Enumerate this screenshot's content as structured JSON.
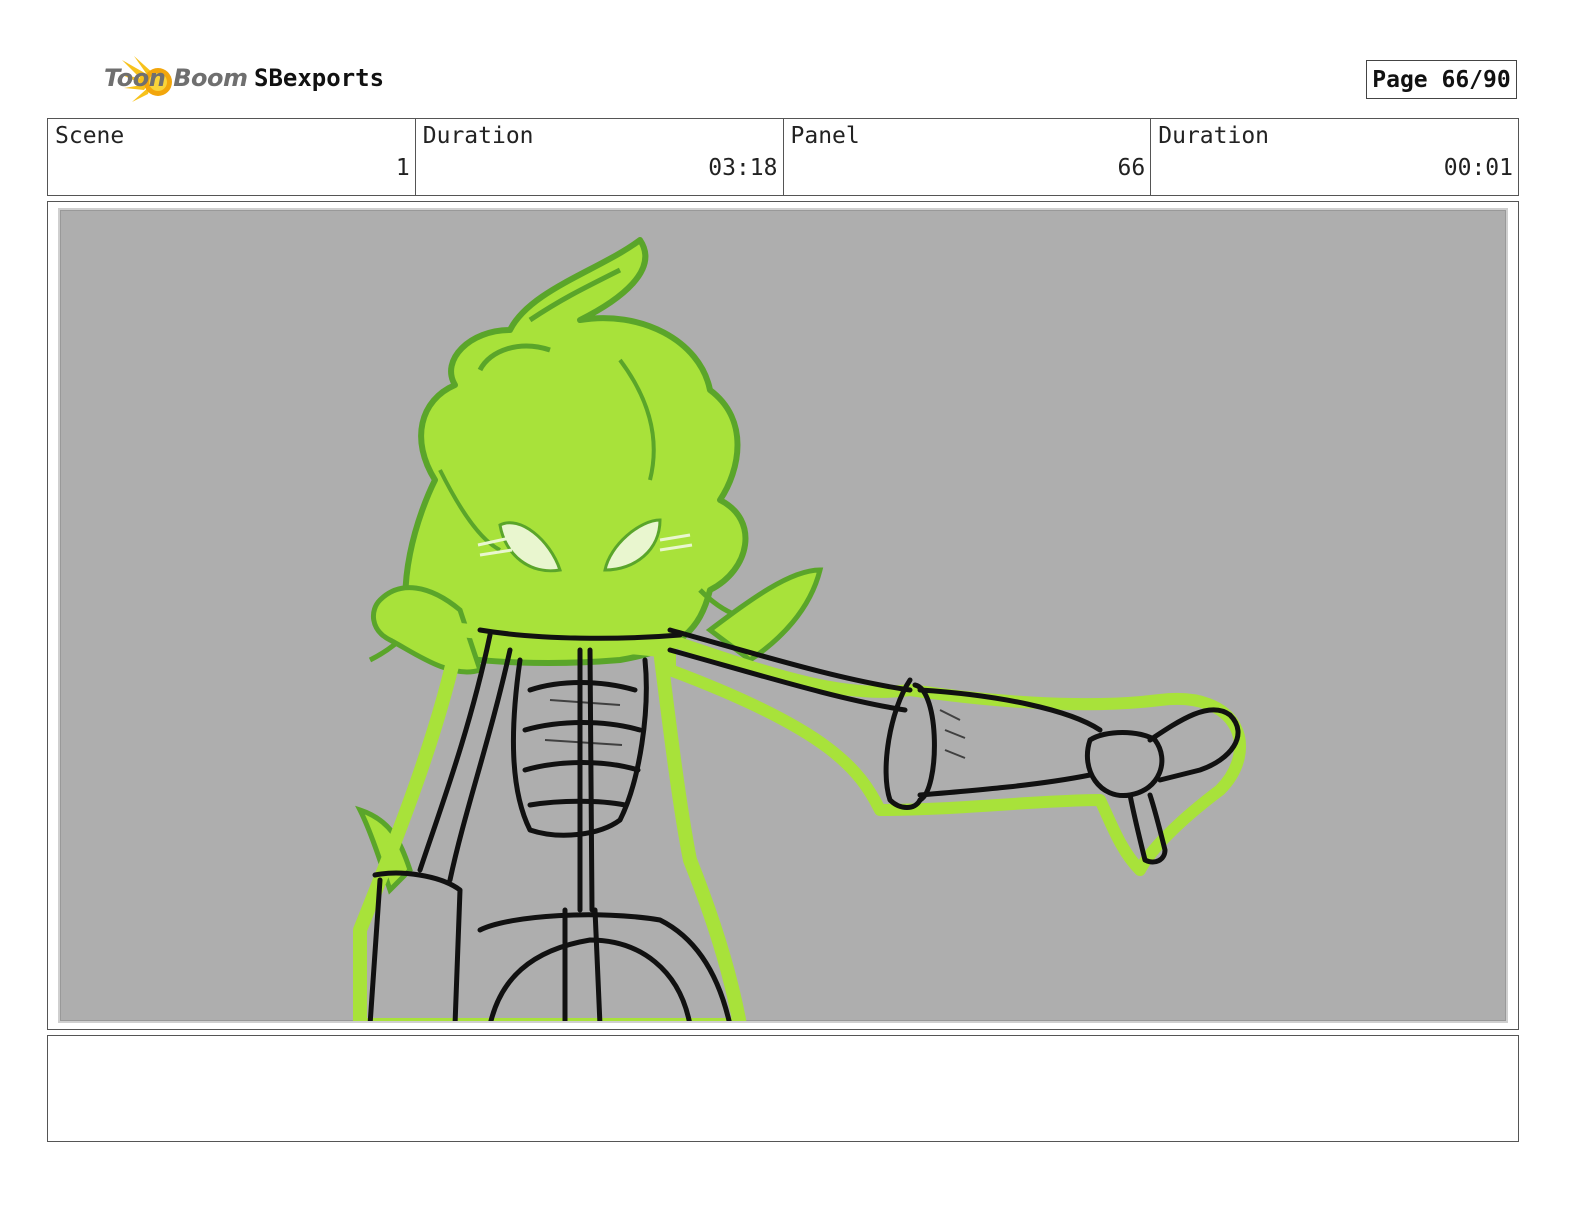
{
  "header": {
    "brand_name": "Toon Boom",
    "project_title": "SBexports",
    "page_label": "Page 66/90"
  },
  "info": {
    "scene_label": "Scene",
    "scene_value": "1",
    "scene_duration_label": "Duration",
    "scene_duration_value": "03:18",
    "panel_label": "Panel",
    "panel_value": "66",
    "panel_duration_label": "Duration",
    "panel_duration_value": "00:01"
  },
  "notes": {
    "text": ""
  },
  "colors": {
    "panel_background": "#aeaeae",
    "flame_green": "#a8e23a",
    "flame_outline": "#5aa52a",
    "ink": "#111111",
    "logo_yellow": "#f7c21b"
  }
}
